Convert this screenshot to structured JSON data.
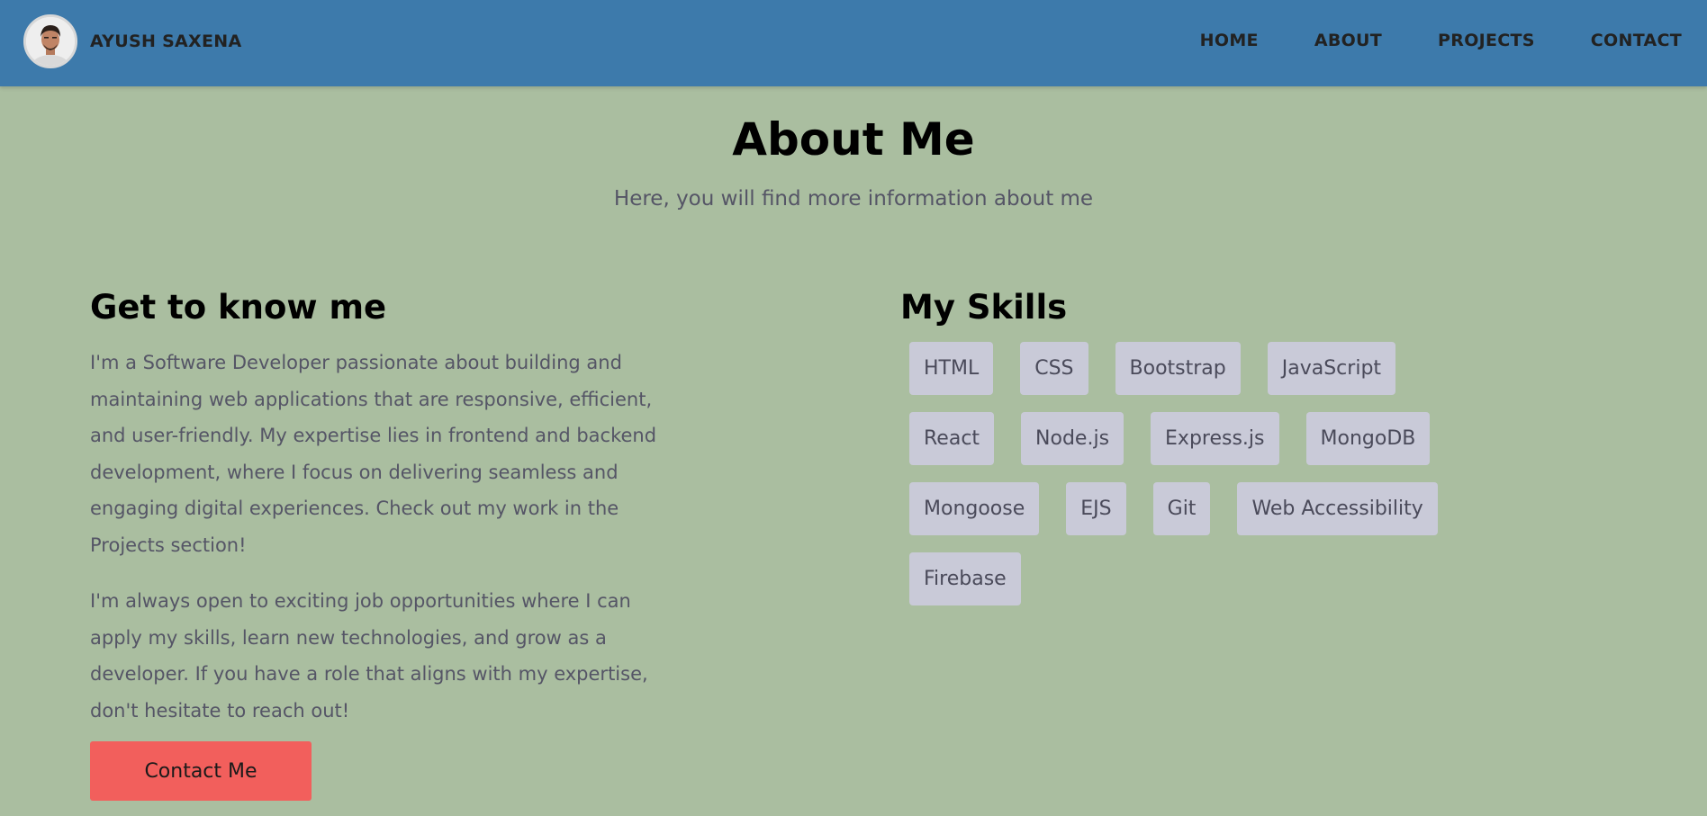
{
  "brand": {
    "name": "AYUSH SAXENA"
  },
  "nav": [
    "HOME",
    "ABOUT",
    "PROJECTS",
    "CONTACT"
  ],
  "hero": {
    "title": "About Me",
    "subtitle": "Here, you will find more information about me"
  },
  "about": {
    "heading": "Get to know me",
    "paragraph1": "I'm a Software Developer passionate about building and maintaining web applications that are responsive, efficient, and user-friendly. My expertise lies in frontend and backend development, where I focus on delivering seamless and engaging digital experiences. Check out my work in the Projects section!",
    "paragraph2": "I'm always open to exciting job opportunities where I can apply my skills, learn new technologies, and grow as a developer. If you have a role that aligns with my expertise, don't hesitate to reach out!",
    "cta_label": "Contact Me"
  },
  "skills": {
    "heading": "My Skills",
    "items": [
      "HTML",
      "CSS",
      "Bootstrap",
      "JavaScript",
      "React",
      "Node.js",
      "Express.js",
      "MongoDB",
      "Mongoose",
      "EJS",
      "Git",
      "Web Accessibility",
      "Firebase"
    ]
  },
  "colors": {
    "header_bg": "#3d7aab",
    "page_bg": "#aabea0",
    "skill_bg": "#c9cad8",
    "cta_bg": "#f25f5c"
  },
  "icons": {
    "avatar": "profile-photo"
  }
}
